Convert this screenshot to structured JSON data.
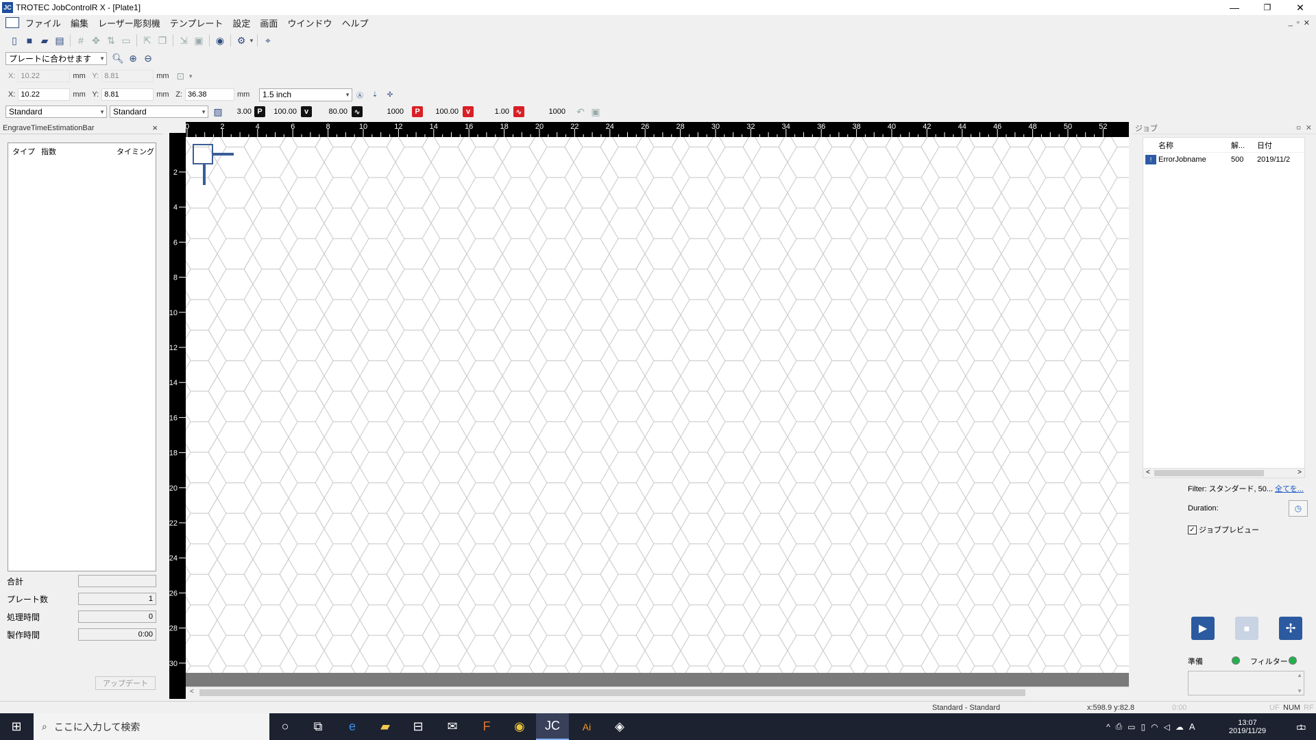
{
  "window": {
    "title": "TROTEC JobControlR X - [Plate1]",
    "controls": {
      "minimize": "—",
      "restore": "❐",
      "close": "✕"
    }
  },
  "menu": {
    "items": [
      "ファイル",
      "編集",
      "レーザー彫刻機",
      "テンプレート",
      "設定",
      "画面",
      "ウインドウ",
      "ヘルプ"
    ]
  },
  "toolbar2": {
    "fit_select": "プレートに合わせます"
  },
  "coords_disabled": {
    "x_label": "X:",
    "x_value": "10.22",
    "x_unit": "mm",
    "y_label": "Y:",
    "y_value": "8.81",
    "y_unit": "mm"
  },
  "coords": {
    "x_label": "X:",
    "x_value": "10.22",
    "x_unit": "mm",
    "y_label": "Y:",
    "y_value": "8.81",
    "y_unit": "mm",
    "z_label": "Z:",
    "z_value": "36.38",
    "z_unit": "mm",
    "lens_select": "1.5 inch"
  },
  "params": {
    "material1": "Standard",
    "material2": "Standard",
    "hatch": "3.00",
    "p1": "100.00",
    "v1": "80.00",
    "freq1": "1000",
    "p2": "100.00",
    "v2": "1.00",
    "freq2": "1000",
    "p_letter": "P",
    "v_letter": "v"
  },
  "left_panel": {
    "title": "EngraveTimeEstimationBar",
    "close": "×",
    "columns": [
      "タイプ",
      "指数",
      "タイミング"
    ],
    "summary": [
      {
        "label": "合計",
        "value": ""
      },
      {
        "label": "プレート数",
        "value": "1"
      },
      {
        "label": "処理時間",
        "value": "0"
      },
      {
        "label": "製作時間",
        "value": "0:00"
      }
    ],
    "update_button": "アップデート"
  },
  "rulers": {
    "h_ticks": [
      "0",
      "2",
      "4",
      "6",
      "8",
      "10",
      "12",
      "14",
      "16",
      "18",
      "20",
      "22",
      "24",
      "26",
      "28",
      "30",
      "32",
      "34",
      "36",
      "38",
      "40",
      "42",
      "44",
      "46",
      "48",
      "50",
      "52"
    ],
    "v_ticks": [
      "2",
      "4",
      "6",
      "8",
      "10",
      "12",
      "14",
      "16",
      "18",
      "20",
      "22",
      "24",
      "26",
      "28",
      "30"
    ]
  },
  "right_panel": {
    "title": "ジョブ",
    "pin": "ㅁ",
    "close": "✕",
    "columns": [
      "名称",
      "解...",
      "日付"
    ],
    "jobs": [
      {
        "name": "ErrorJobname",
        "res": "500",
        "date": "2019/11/2"
      }
    ],
    "filter_text": "Filter: スタンダード, 50...",
    "filter_link": "全てを...",
    "duration_label": "Duration:",
    "preview_label": "ジョブプレビュー",
    "preview_checked": true,
    "ready_label": "準備",
    "filter_label": "フィルター",
    "status_color": "#22b14c"
  },
  "status_bar": {
    "material": "Standard - Standard",
    "coords": "x:598.9  y:82.8",
    "time": "0:00",
    "indicators": [
      "UF",
      "NUM",
      "RF"
    ]
  },
  "taskbar": {
    "search_placeholder": "ここに入力して検索",
    "time": "13:07",
    "date": "2019/11/29",
    "ime": "A",
    "notifications": "1"
  }
}
